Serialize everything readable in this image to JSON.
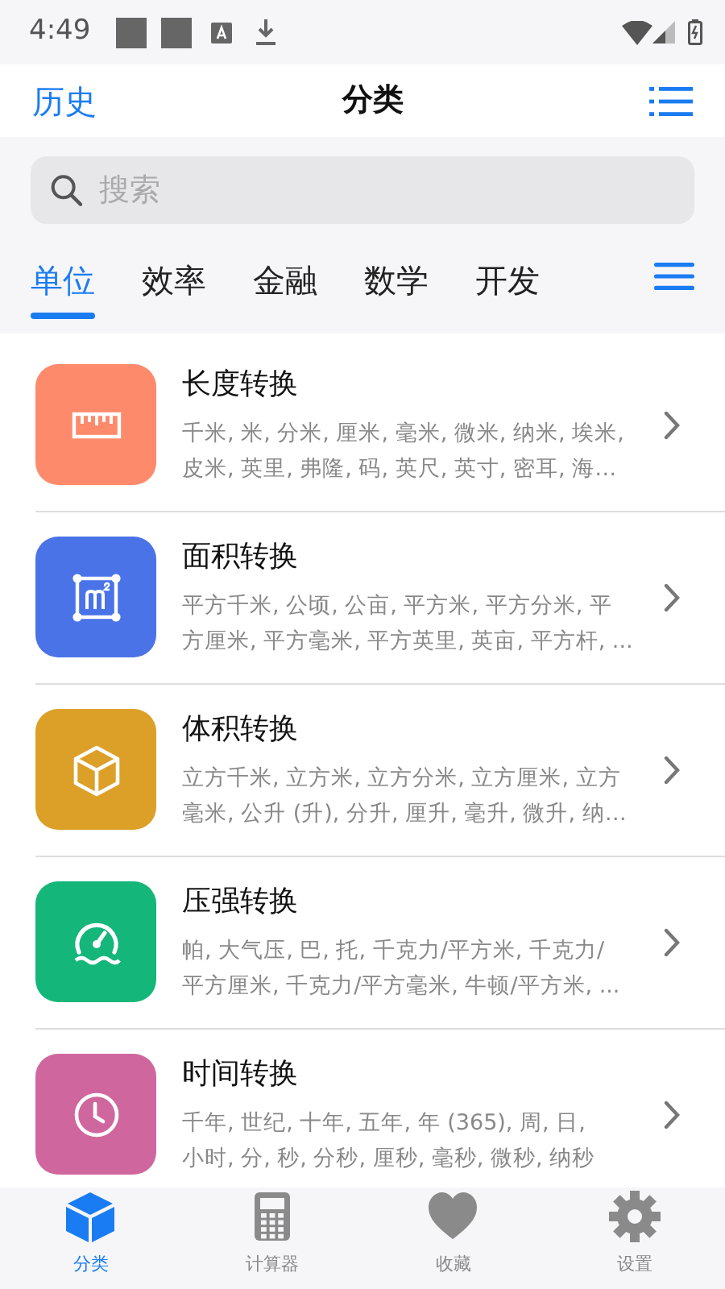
{
  "status_bar": {
    "time": "4:49"
  },
  "header": {
    "left_link": "历史",
    "title": "分类"
  },
  "search": {
    "placeholder": "搜索"
  },
  "tabs": [
    {
      "label": "单位",
      "selected": true
    },
    {
      "label": "效率",
      "selected": false
    },
    {
      "label": "金融",
      "selected": false
    },
    {
      "label": "数学",
      "selected": false
    },
    {
      "label": "开发",
      "selected": false
    }
  ],
  "items": [
    {
      "kind": "ruler",
      "color": "#fe8a6c",
      "title": "长度转换",
      "lines": [
        "千米, 米, 分米, 厘米, 毫米, 微米, 纳米, 埃米,",
        "皮米, 英里, 弗隆, 码, 英尺, 英寸, 密耳, 海…"
      ]
    },
    {
      "kind": "area",
      "color": "#4a73e8",
      "title": "面积转换",
      "lines": [
        "平方千米, 公顷, 公亩, 平方米, 平方分米, 平",
        "方厘米, 平方毫米, 平方英里, 英亩, 平方杆, ..."
      ]
    },
    {
      "kind": "cube",
      "color": "#dca028",
      "title": "体积转换",
      "lines": [
        "立方千米, 立方米, 立方分米, 立方厘米, 立方",
        "毫米, 公升 (升), 分升, 厘升, 毫升, 微升, 纳…"
      ]
    },
    {
      "kind": "gauge",
      "color": "#14b67a",
      "title": "压强转换",
      "lines": [
        "帕, 大气压, 巴, 托, 千克力/平方米, 千克力/",
        "平方厘米, 千克力/平方毫米, 牛顿/平方米, ..."
      ]
    },
    {
      "kind": "clock",
      "color": "#cf679e",
      "title": "时间转换",
      "lines": [
        "千年, 世纪, 十年, 五年, 年 (365), 周, 日,",
        "小时, 分, 秒, 分秒, 厘秒, 毫秒, 微秒, 纳秒"
      ]
    }
  ],
  "bottom_nav": [
    {
      "kind": "cube",
      "label": "分类",
      "selected": true
    },
    {
      "kind": "calculator",
      "label": "计算器",
      "selected": false
    },
    {
      "kind": "heart",
      "label": "收藏",
      "selected": false
    },
    {
      "kind": "gear",
      "label": "设置",
      "selected": false
    }
  ]
}
